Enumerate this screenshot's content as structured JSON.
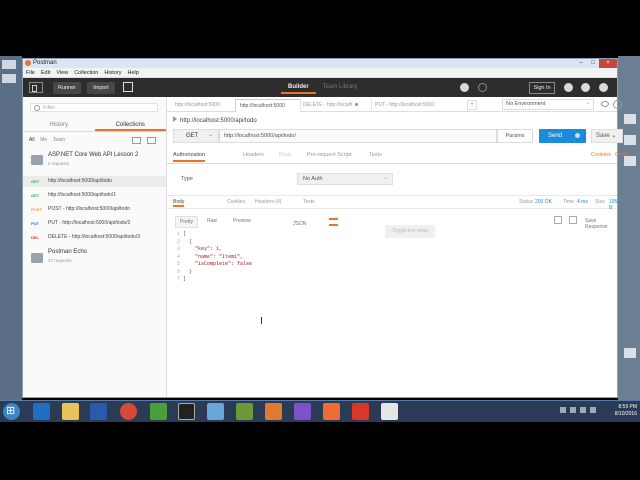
{
  "window": {
    "title": "Postman"
  },
  "menu": [
    "File",
    "Edit",
    "View",
    "Collection",
    "History",
    "Help"
  ],
  "toolbar": {
    "runner": "Runner",
    "import": "Import",
    "tabs": [
      "Builder",
      "Team Library"
    ],
    "signin": "Sign In"
  },
  "sidebar": {
    "filter_placeholder": "Filter",
    "tabs": [
      "History",
      "Collections"
    ],
    "filters": [
      "All",
      "Me",
      "Team"
    ],
    "collections": [
      {
        "name": "ASP.NET Core Web API Lesson 2",
        "count": "5 requests"
      },
      {
        "name": "Postman Echo",
        "count": "37 requests"
      }
    ],
    "requests": [
      {
        "method": "GET",
        "url": "http://localhost:5000/api/todo",
        "color": "#2fa84f"
      },
      {
        "method": "GET",
        "url": "http://localhost:5000/api/todo/1",
        "color": "#2fa84f"
      },
      {
        "method": "POST",
        "url": "POST - http://localhost:5000/api/todo",
        "color": "#e8a33d"
      },
      {
        "method": "PUT",
        "url": "PUT - http://localhost:5000/api/todo/2",
        "color": "#1a73c9"
      },
      {
        "method": "DEL",
        "url": "DELETE - http://localhost:5000/api/todo/3",
        "color": "#d9372b"
      }
    ]
  },
  "request_tabs": [
    "http://localhost:5000",
    "http://localhost:5000",
    "DELETE - http://localh",
    "PUT - http://localhost:5000"
  ],
  "environment": "No Environment",
  "request": {
    "title": "http://localhost:5000/api/todo",
    "method": "GET",
    "url": "http://localhost:5000/api/todo/",
    "params": "Params",
    "send": "Send",
    "save": "Save",
    "tabs": [
      "Authorization",
      "Headers",
      "Body",
      "Pre-request Script",
      "Tests"
    ],
    "links": [
      "Cookies",
      "Code"
    ],
    "type_label": "Type",
    "auth_type": "No Auth"
  },
  "response": {
    "tabs": [
      "Body",
      "Cookies",
      "Headers (4)",
      "Tests"
    ],
    "status_label": "Status",
    "status_value": "200 OK",
    "time_label": "Time",
    "time_value": "4 ms",
    "size_label": "Size",
    "size_value": "195 B",
    "view_modes": [
      "Pretty",
      "Raw",
      "Preview"
    ],
    "format": "JSON",
    "tooltip": "Toggle line wrap",
    "save_response": "Save Response",
    "lines": [
      {
        "n": "1",
        "text": "["
      },
      {
        "n": "2",
        "text": "  {"
      },
      {
        "n": "3",
        "text": "    \"key\": 1,"
      },
      {
        "n": "4",
        "text": "    \"name\": \"Item1\","
      },
      {
        "n": "5",
        "text": "    \"isComplete\": false"
      },
      {
        "n": "6",
        "text": "  }"
      },
      {
        "n": "7",
        "text": "]"
      }
    ]
  },
  "clock": {
    "time": "8:59 PM",
    "date": "8/10/2016"
  },
  "colors": {
    "accent": "#f47023",
    "send": "#1a8cd8",
    "toolbar": "#2d2d2d"
  }
}
